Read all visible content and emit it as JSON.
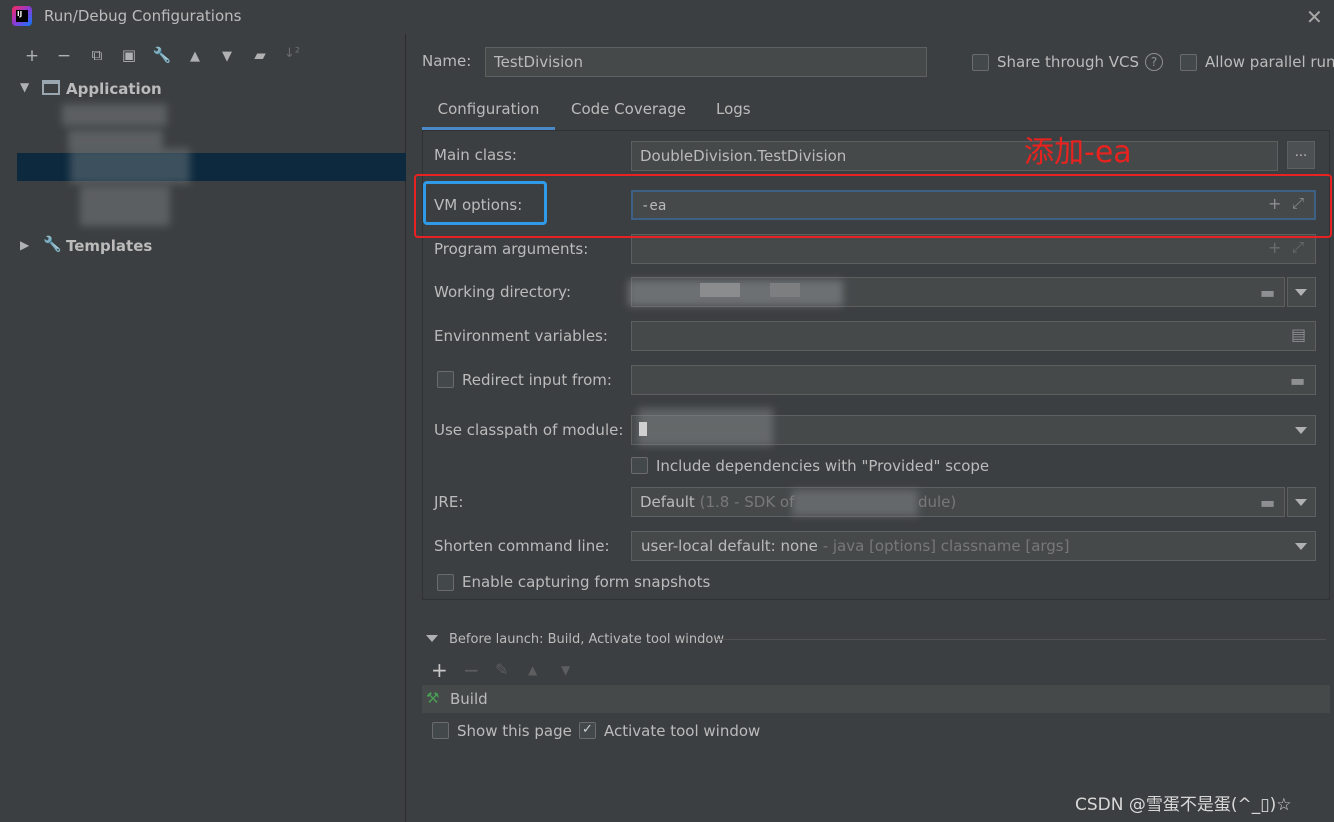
{
  "window": {
    "title": "Run/Debug Configurations"
  },
  "tree": {
    "application_label": "Application",
    "templates_label": "Templates"
  },
  "form": {
    "name_label": "Name:",
    "name_value": "TestDivision",
    "share_vcs_label": "Share through VCS",
    "allow_parallel_label": "Allow parallel run",
    "tabs": [
      "Configuration",
      "Code Coverage",
      "Logs"
    ],
    "main_class_label": "Main class:",
    "main_class_value": "DoubleDivision.TestDivision",
    "browse_label": "...",
    "vm_options_label": "VM options:",
    "vm_options_value": "-ea",
    "program_args_label": "Program arguments:",
    "working_dir_label": "Working directory:",
    "env_vars_label": "Environment variables:",
    "redirect_label": "Redirect input from:",
    "classpath_label": "Use classpath of module:",
    "include_deps_label": "Include dependencies with \"Provided\" scope",
    "jre_label": "JRE:",
    "jre_value_main": "Default",
    "jre_value_muted_a": "(1.8 - SDK of",
    "jre_value_muted_b": "dule)",
    "shorten_label": "Shorten command line:",
    "shorten_value_main": "user-local default: none",
    "shorten_value_muted": "- java [options] classname [args]",
    "capture_label": "Enable capturing form snapshots"
  },
  "annotation": {
    "text": "添加-ea"
  },
  "before_launch": {
    "header": "Before launch: Build, Activate tool window",
    "item": "Build",
    "show_page_label": "Show this page",
    "activate_label": "Activate tool window",
    "activate_checked": true
  },
  "watermark": "CSDN @雪蛋不是蛋(^_▯)☆",
  "colors": {
    "accent": "#4a88c7",
    "annotation_red": "#e8231f",
    "highlight_blue": "#2f9be8"
  }
}
